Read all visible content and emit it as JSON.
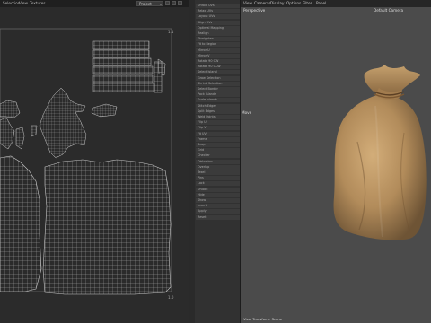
{
  "uv_editor": {
    "menu": [
      "Selection",
      "View",
      "Textures"
    ],
    "project_dropdown": "Project",
    "corner_labels": {
      "top": "1.1",
      "bottom": "1.0"
    }
  },
  "command_panel": {
    "rows": [
      "Unfold UVs",
      "Relax UVs",
      "Layout UVs",
      "Align UVs",
      "Optimal Mapping",
      "Realign",
      "Straighten",
      "Fit to Region",
      "Mirror U",
      "Mirror V",
      "Rotate 90 CW",
      "Rotate 90 CCW",
      "Select Island",
      "Grow Selection",
      "Shrink Selection",
      "Select Border",
      "Pack Islands",
      "Scale Islands",
      "Stitch Edges",
      "Split Edges",
      "Weld Points",
      "Flip U",
      "Flip V",
      "Fit UV",
      "Frame",
      "Snap",
      "Grid",
      "Checker",
      "Distortion",
      "Overlap",
      "Texel",
      "Pins",
      "Lock",
      "Unlock",
      "Hide",
      "Show",
      "Invert",
      "Apply",
      "Reset"
    ]
  },
  "viewport": {
    "menu": [
      "View",
      "Cameras",
      "Display",
      "Options",
      "Filter",
      "Panel"
    ],
    "view_name": "Perspective",
    "camera": "Default Camera",
    "side_label": "Move",
    "status": "View Transform: Scene"
  },
  "colors": {
    "uv_bg": "#2b2b2b",
    "viewport_bg": "#4b4b4b",
    "burlap": "#b8915e",
    "wire": "#b9b9b9"
  }
}
